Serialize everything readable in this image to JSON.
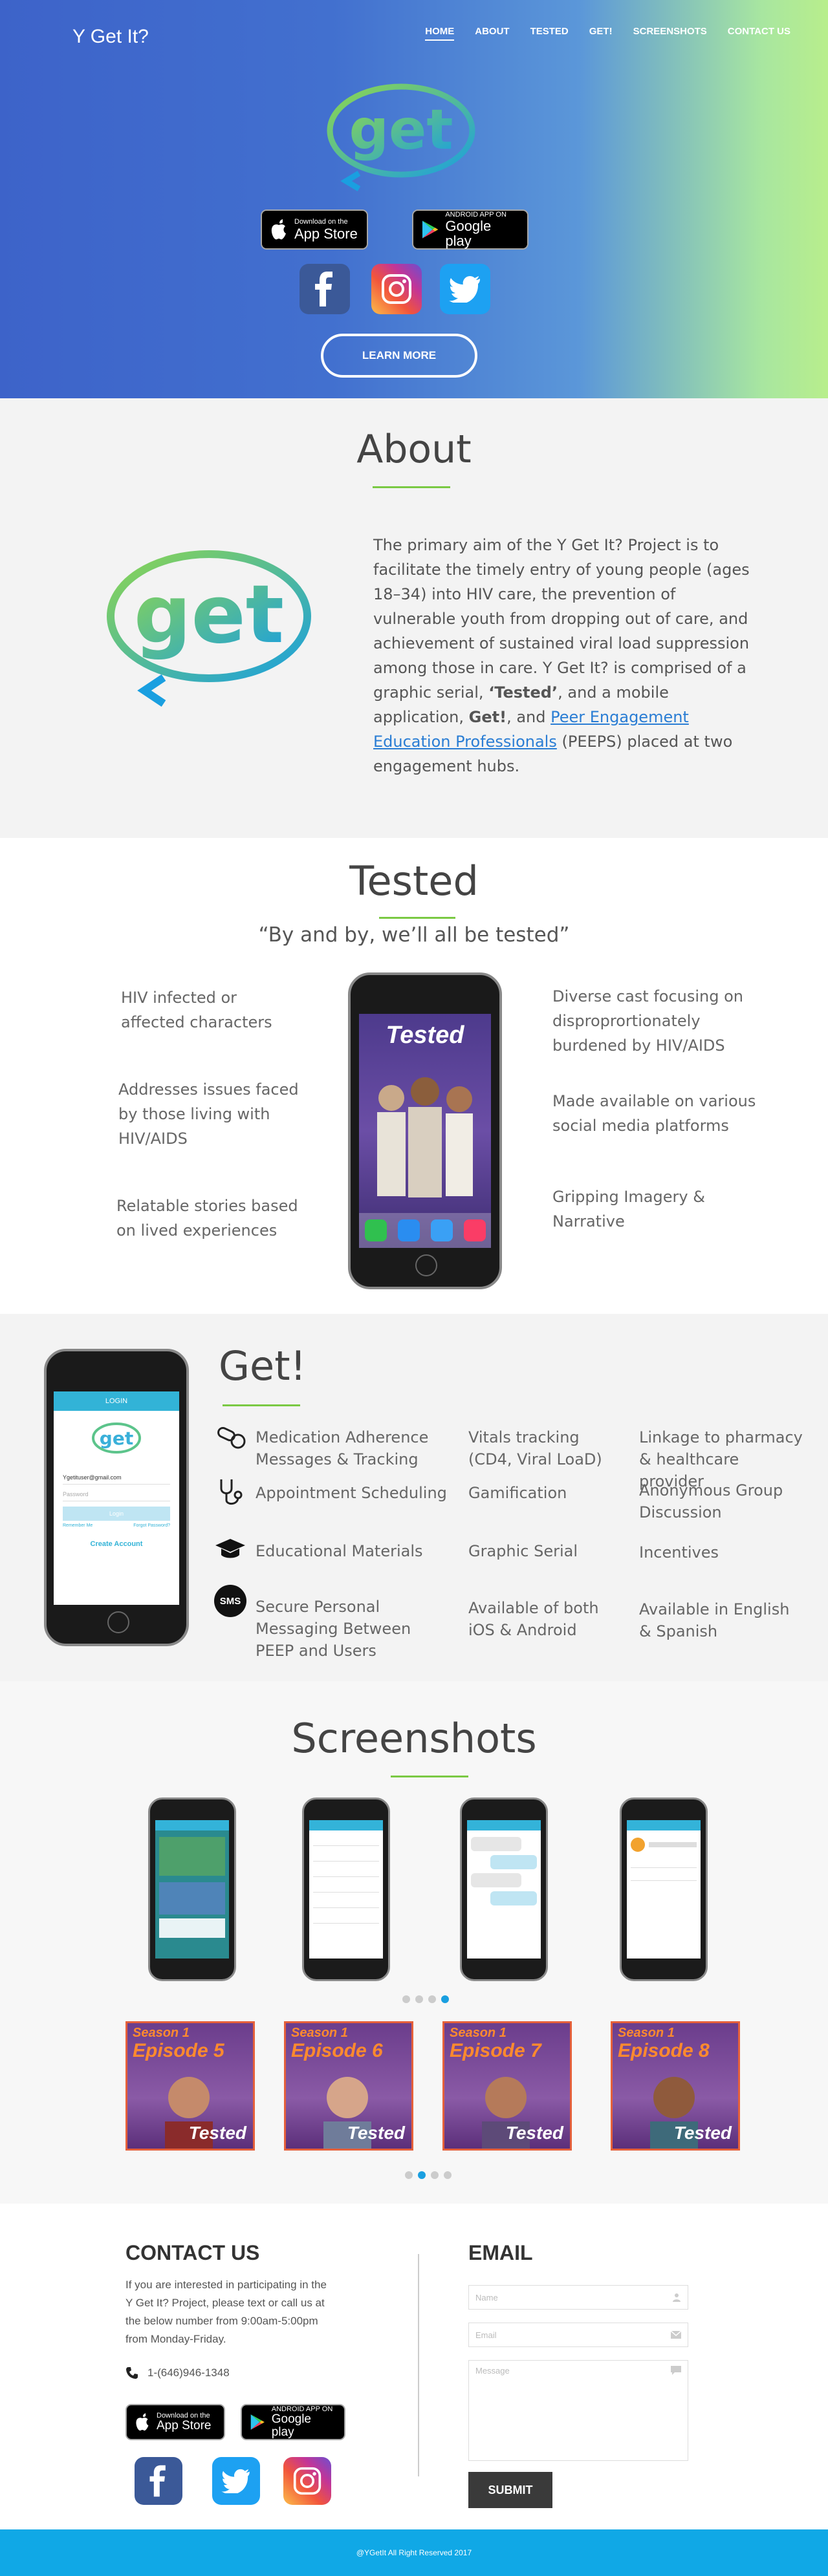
{
  "header": {
    "brand": "Y Get It?",
    "nav": [
      "HOME",
      "ABOUT",
      "TESTED",
      "GET!",
      "SCREENSHOTS",
      "CONTACT US"
    ]
  },
  "hero": {
    "logo_text": "get",
    "app_store": {
      "line1": "Download on the",
      "line2": "App Store"
    },
    "google_play": {
      "line1": "ANDROID APP ON",
      "line2": "Google play"
    },
    "learn_more": "LEARN MORE"
  },
  "about": {
    "title": "About",
    "logo_text": "get",
    "text_1": "The primary aim of the Y Get It? Project is to facilitate the timely entry of young people (ages 18–34) into HIV care, the prevention of vulnerable youth from dropping out of care, and achievement of sustained viral load suppression among those in care. Y Get It? is comprised of a graphic serial, ",
    "bold_1": "‘Tested’",
    "text_2": ", and a mobile application, ",
    "bold_2": "Get!",
    "text_3": ", and ",
    "link": "Peer Engagement Education Professionals",
    "text_4": " (PEEPS) placed at two engagement hubs."
  },
  "tested": {
    "title": "Tested",
    "quote": "“By and by, we’ll all be tested”",
    "phone_title": "Tested",
    "left": [
      "HIV infected or affected characters",
      "Addresses issues faced by those living with HIV/AIDS",
      "Relatable stories based on lived experiences"
    ],
    "right": [
      "Diverse cast focusing on disproprortionately burdened by HIV/AIDS",
      "Made available on various social media platforms",
      "Gripping Imagery & Narrative"
    ]
  },
  "get": {
    "title": "Get!",
    "phone": {
      "header": "LOGIN",
      "email": "Ygetituser@gmail.com",
      "password": "Password",
      "login": "Login",
      "remember": "Remember Me",
      "forgot": "Forgot Password?",
      "create": "Create Account",
      "logo": "get"
    },
    "col1": [
      "Medication Adherence Messages & Tracking",
      "Appointment Scheduling",
      "Educational Materials",
      "Secure Personal Messaging Between PEEP and Users"
    ],
    "col2": [
      "Vitals tracking (CD4, Viral LoaD)",
      "Gamification",
      "Graphic Serial",
      "Available of both iOS & Android"
    ],
    "col3": [
      "Linkage to pharmacy & healthcare provider",
      "Anonymous Group Discussion",
      "Incentives",
      "Available in English & Spanish"
    ],
    "sms_icon": "SMS"
  },
  "screenshots": {
    "title": "Screenshots",
    "episodes": [
      {
        "season": "Season 1",
        "episode": "Episode 5",
        "brand": "Tested"
      },
      {
        "season": "Season 1",
        "episode": "Episode 6",
        "brand": "Tested"
      },
      {
        "season": "Season 1",
        "episode": "Episode 7",
        "brand": "Tested"
      },
      {
        "season": "Season 1",
        "episode": "Episode 8",
        "brand": "Tested"
      }
    ]
  },
  "contact": {
    "title": "CONTACT US",
    "text": "If you are interested in participating in the Y Get It? Project, please text or call us at the below number from 9:00am-5:00pm from Monday-Friday.",
    "phone": "1-(646)946-1348",
    "email_title": "EMAIL",
    "name_placeholder": "Name",
    "email_placeholder": "Email",
    "message_placeholder": "Message",
    "submit": "SUBMIT"
  },
  "footer": {
    "text": "@YGetIt All Right Reserved 2017"
  },
  "colors": {
    "accent_green": "#7ac943",
    "footer_blue": "#10a8e6",
    "link_blue": "#2a7dd4"
  }
}
